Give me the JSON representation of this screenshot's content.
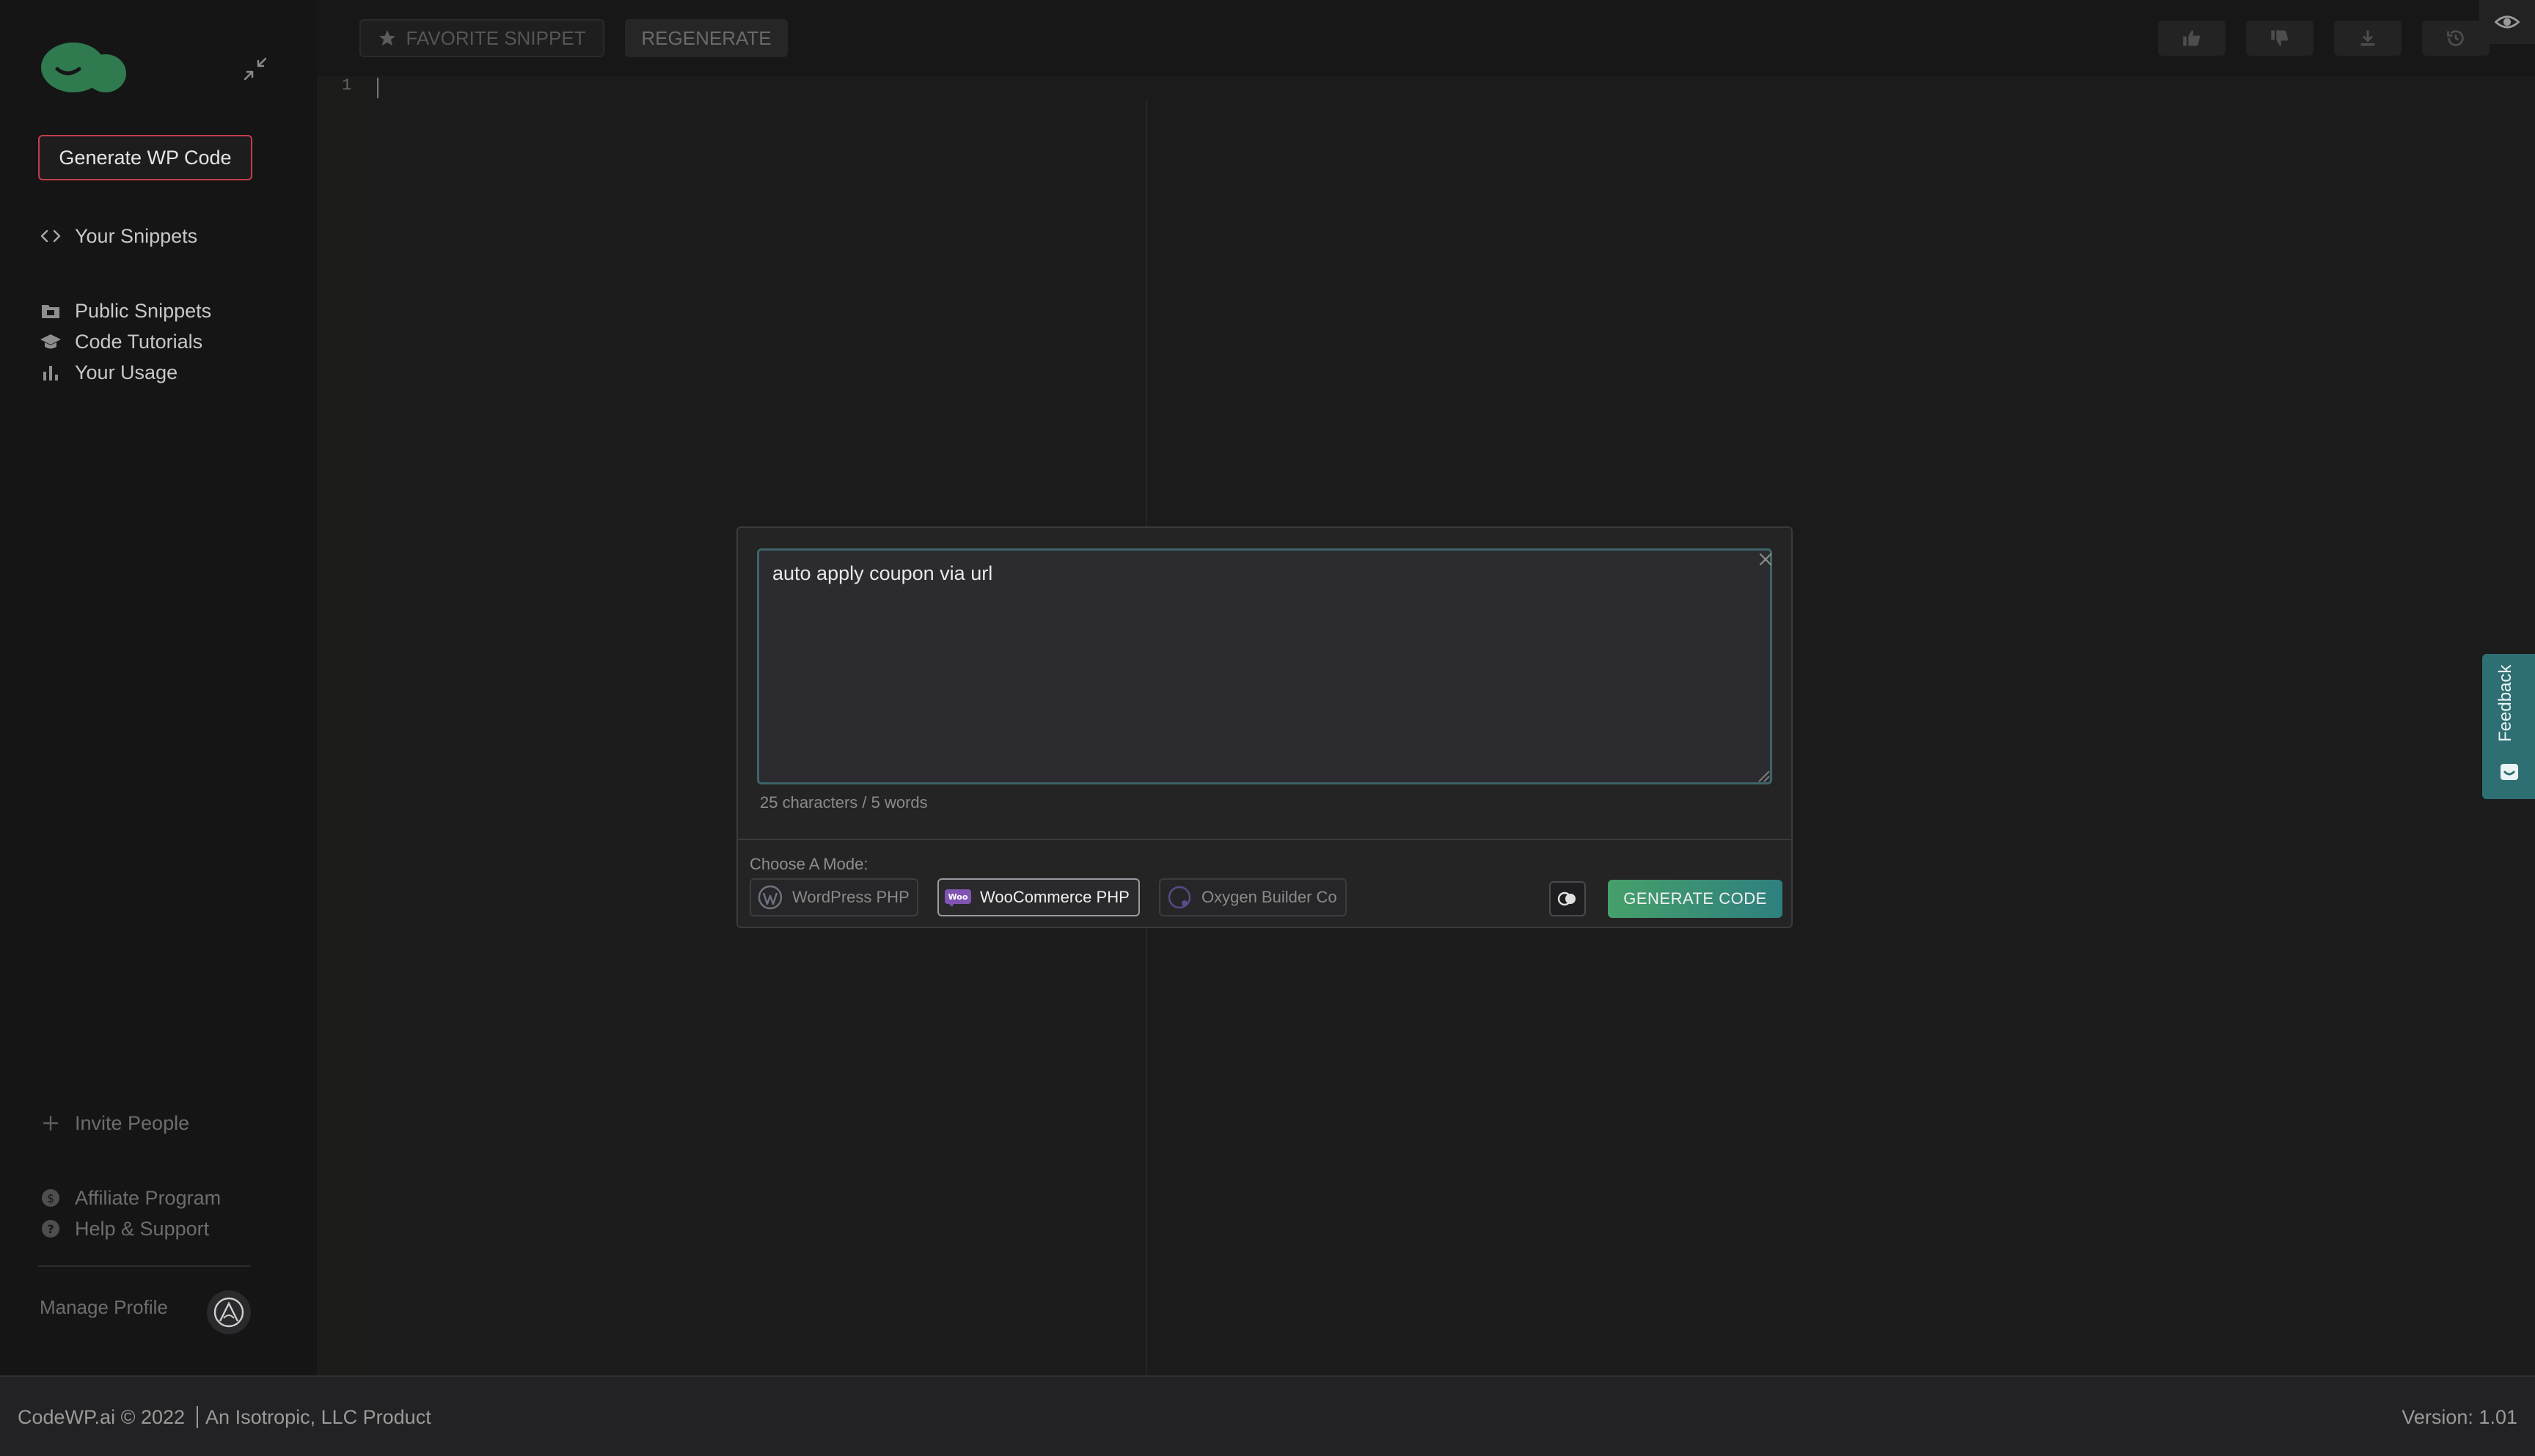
{
  "sidebar": {
    "generate_button": "Generate WP Code",
    "items_primary": [
      {
        "label": "Your Snippets",
        "icon": "code-icon"
      }
    ],
    "items_secondary": [
      {
        "label": "Public Snippets",
        "icon": "folder-icon"
      },
      {
        "label": "Code Tutorials",
        "icon": "graduation-cap-icon"
      },
      {
        "label": "Your Usage",
        "icon": "bar-chart-icon"
      }
    ],
    "invite": "Invite People",
    "affiliate": "Affiliate Program",
    "help": "Help & Support",
    "manage_profile": "Manage Profile"
  },
  "toolbar": {
    "favorite": "FAVORITE SNIPPET",
    "regenerate": "REGENERATE"
  },
  "editor": {
    "line_number": "1"
  },
  "modal": {
    "prompt_value": "auto apply coupon via url",
    "counter": "25 characters / 5 words",
    "mode_label": "Choose A Mode:",
    "modes": [
      {
        "label": "WordPress PHP",
        "icon": "wordpress-icon",
        "active": false
      },
      {
        "label": "WooCommerce PHP",
        "icon": "woocommerce-icon",
        "active": true
      },
      {
        "label": "Oxygen Builder Co",
        "icon": "oxygen-icon",
        "active": false
      }
    ],
    "generate": "GENERATE CODE",
    "woo_badge": "Woo"
  },
  "feedback": {
    "label": "Feedback"
  },
  "footer": {
    "copyright": "CodeWP.ai © 2022",
    "company": "An Isotropic, LLC Product",
    "version": "Version: 1.01"
  },
  "colors": {
    "accent_green": "#46a06a",
    "accent_teal": "#2e7f7f",
    "brand_red": "#c13d4c",
    "logo_green": "#2f7a4e"
  }
}
